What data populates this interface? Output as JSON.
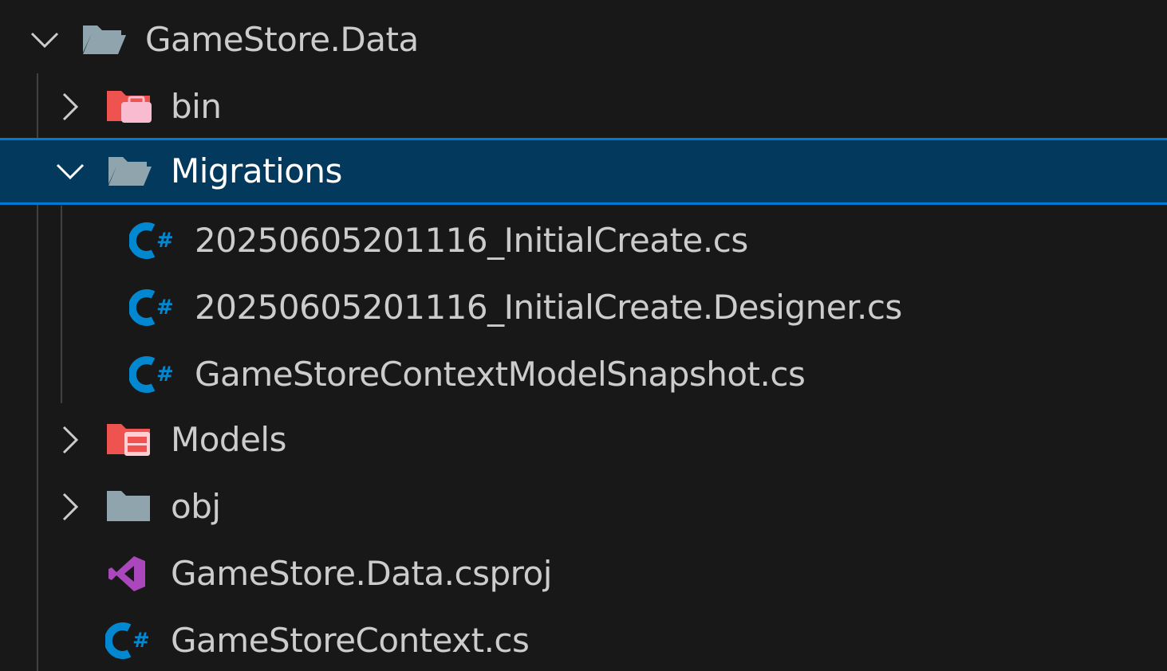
{
  "explorer": {
    "root": {
      "label": "GameStore.Data",
      "expanded": true,
      "icon": "folder-open-icon"
    },
    "items": [
      {
        "label": "bin",
        "kind": "folder",
        "expanded": false,
        "icon": "folder-bin-icon"
      },
      {
        "label": "Migrations",
        "kind": "folder",
        "expanded": true,
        "selected": true,
        "icon": "folder-open-icon",
        "children": [
          {
            "label": "20250605201116_InitialCreate.cs",
            "kind": "file",
            "icon": "csharp-file-icon"
          },
          {
            "label": "20250605201116_InitialCreate.Designer.cs",
            "kind": "file",
            "icon": "csharp-file-icon"
          },
          {
            "label": "GameStoreContextModelSnapshot.cs",
            "kind": "file",
            "icon": "csharp-file-icon"
          }
        ]
      },
      {
        "label": "Models",
        "kind": "folder",
        "expanded": false,
        "icon": "folder-models-icon"
      },
      {
        "label": "obj",
        "kind": "folder",
        "expanded": false,
        "icon": "folder-icon"
      },
      {
        "label": "GameStore.Data.csproj",
        "kind": "file",
        "icon": "visual-studio-project-icon"
      },
      {
        "label": "GameStoreContext.cs",
        "kind": "file",
        "icon": "csharp-file-icon"
      }
    ]
  },
  "colors": {
    "background": "#181818",
    "selection_background": "#04395e",
    "selection_border": "#0078d4",
    "text": "#cccccc",
    "text_selected": "#ffffff",
    "folder_grey": "#90a4ae",
    "folder_red": "#ef5350",
    "csharp_blue": "#0288d1",
    "vs_purple": "#ab47bc"
  }
}
